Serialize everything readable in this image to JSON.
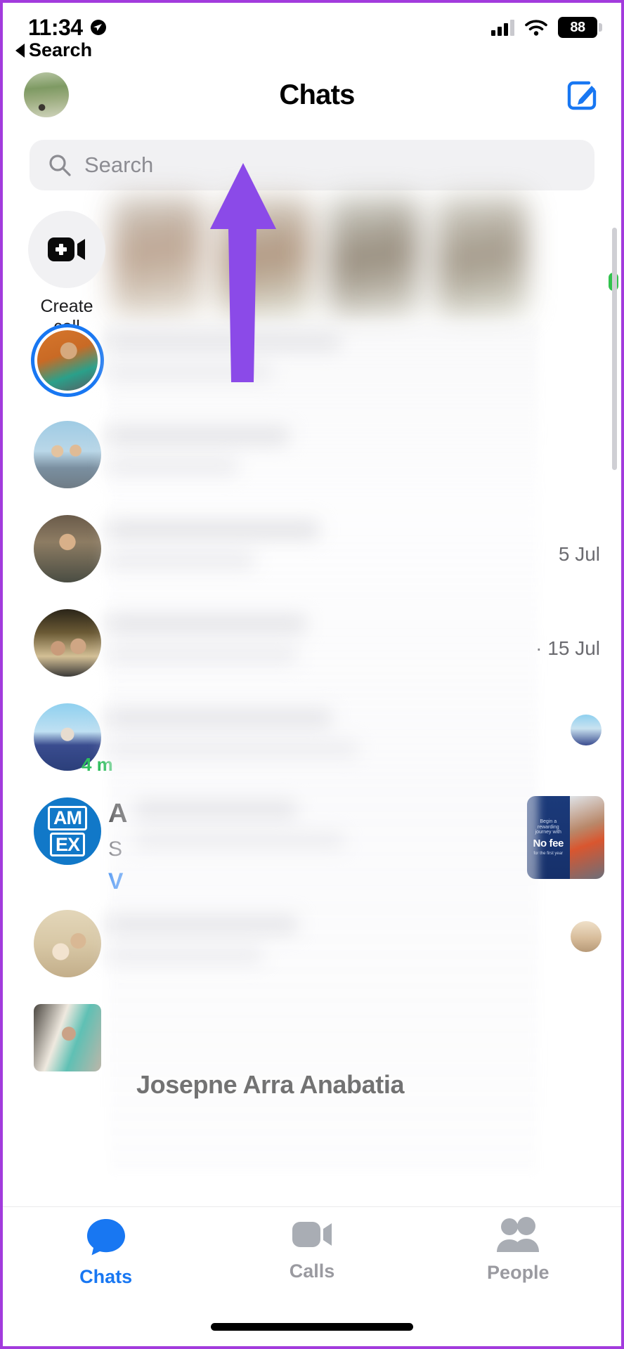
{
  "status_bar": {
    "time": "11:34",
    "location_icon": "location-arrow-icon",
    "signal_icon": "cellular-signal-icon",
    "wifi_icon": "wifi-icon",
    "battery_percent": "88"
  },
  "back_nav": {
    "label": "Search",
    "icon": "back-triangle-icon"
  },
  "header": {
    "title": "Chats",
    "avatar_name": "profile-avatar",
    "compose_label": "compose-icon"
  },
  "search": {
    "placeholder": "Search",
    "icon": "search-icon"
  },
  "active_row": {
    "create_call_line1": "Create",
    "create_call_line2": "call",
    "create_call_icon": "video-plus-icon"
  },
  "chats": [
    {
      "avatar": "p1",
      "timestamp": "",
      "accessory": "",
      "unread_ring": true
    },
    {
      "avatar": "p2",
      "timestamp": "",
      "accessory": ""
    },
    {
      "avatar": "p3",
      "timestamp": "5 Jul",
      "accessory": ""
    },
    {
      "avatar": "p4",
      "timestamp": "· 15 Jul",
      "accessory": ""
    },
    {
      "avatar": "p5",
      "timestamp": "",
      "accessory": "mini-thumb",
      "badge": "4 m"
    },
    {
      "avatar": "p6",
      "timestamp": "",
      "accessory": "ad-card",
      "name_initial": "A",
      "sub_initial": "S",
      "link_initial": "V",
      "ad_line1": "Begin a rewarding journey with",
      "ad_line2": "No fee",
      "ad_line3": "for the first year"
    },
    {
      "avatar": "p7",
      "timestamp": "",
      "accessory": "mini-thumb-b"
    },
    {
      "avatar": "p8",
      "timestamp": "",
      "accessory": "",
      "name": "Josepne Arra Anabatia"
    }
  ],
  "tabs": [
    {
      "label": "Chats",
      "icon": "chat-bubble-icon",
      "active": true
    },
    {
      "label": "Calls",
      "icon": "video-camera-icon",
      "active": false
    },
    {
      "label": "People",
      "icon": "people-icon",
      "active": false
    }
  ],
  "annotation": {
    "arrow_color": "#8b4ae8",
    "frame_color": "#a23bdd"
  }
}
